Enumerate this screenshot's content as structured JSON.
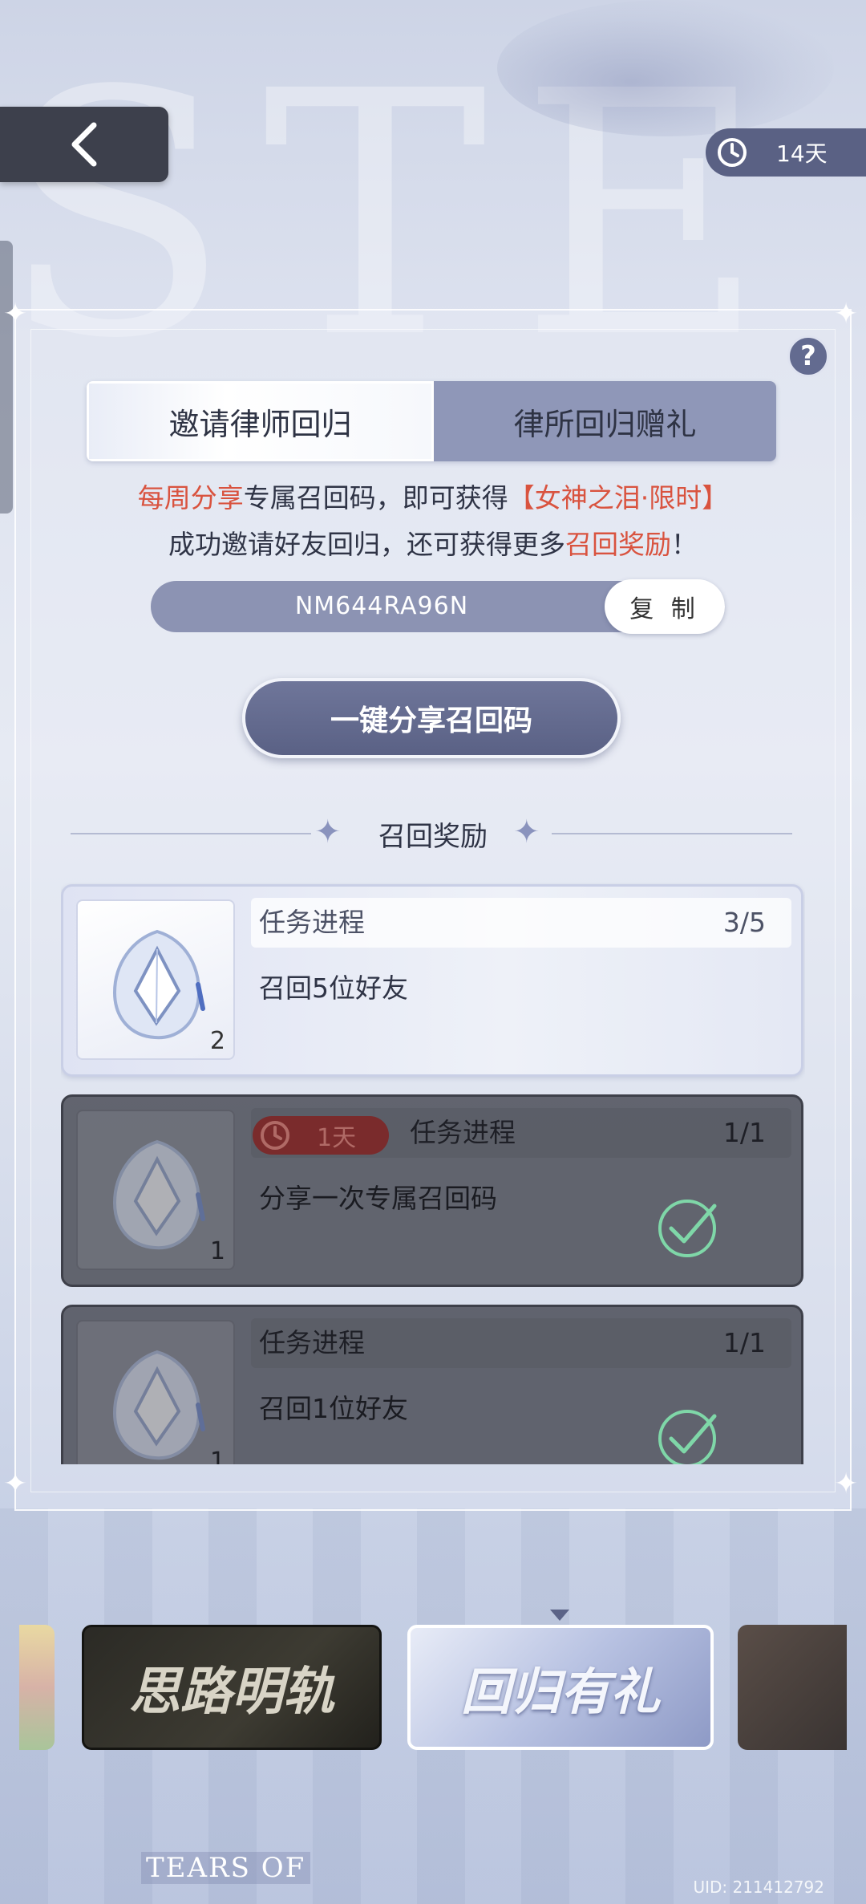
{
  "header": {
    "timer_text": "14天"
  },
  "tabs": [
    {
      "label": "邀请律师回归",
      "active": true
    },
    {
      "label": "律所回归赠礼",
      "active": false
    }
  ],
  "description": {
    "line1_red1": "每周分享",
    "line1_mid": "专属召回码，即可获得",
    "line1_red2": "【女神之泪·限时】",
    "line2_start": "成功邀请好友回归，还可获得更多",
    "line2_red": "召回奖励",
    "line2_end": "！"
  },
  "recall_code": {
    "code": "NM644RA96N",
    "copy_label": "复 制"
  },
  "share_button_label": "一键分享召回码",
  "section_title": "召回奖励",
  "tasks": [
    {
      "progress_label": "任务进程",
      "progress": "3/5",
      "name": "召回5位好友",
      "reward_count": "2",
      "state": "in-progress"
    },
    {
      "progress_label": "任务进程",
      "progress": "1/1",
      "name": "分享一次专属召回码",
      "reward_count": "1",
      "state": "completed",
      "time_limit": "1天"
    },
    {
      "progress_label": "任务进程",
      "progress": "1/1",
      "name": "召回1位好友",
      "reward_count": "1",
      "state": "completed"
    }
  ],
  "carousel": {
    "items": [
      "思路明轨",
      "回归有礼"
    ],
    "selected_index": 1
  },
  "footer": {
    "brand": "TEARS OF",
    "uid": "UID: 211412792"
  },
  "colors": {
    "accent": "#5a6185",
    "highlight_red": "#d9533f",
    "check_green": "#7fd7a8"
  },
  "icons": [
    "back-arrow-icon",
    "clock-icon",
    "help-icon",
    "sparkle-icon",
    "gem-icon",
    "checkmark-icon"
  ]
}
